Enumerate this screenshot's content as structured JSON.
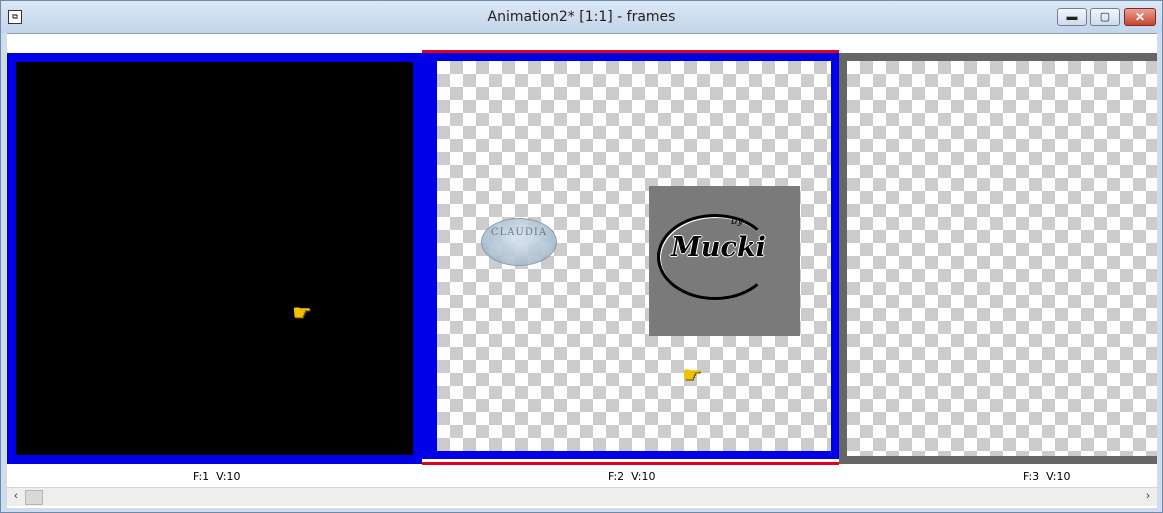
{
  "window": {
    "title": "Animation2* [1:1] - frames",
    "icon": "app-icon",
    "controls": {
      "minimize_glyph": "▬",
      "maximize_glyph": "▢",
      "close_glyph": "✕"
    }
  },
  "frames": [
    {
      "label": "F:1  V:10",
      "background": "#000000",
      "selected": true
    },
    {
      "label": "F:2  V:10",
      "background": "transparent-checker",
      "selected": true,
      "current": true,
      "stamp_text": "CLAUDIA",
      "logo_text": "Mucki",
      "logo_small": "by"
    },
    {
      "label": "F:3  V:10",
      "background": "transparent-checker",
      "selected": false
    }
  ],
  "colors": {
    "selection_border": "#0000e6",
    "current_frame_marker": "#e0001a",
    "frame_border": "#666666"
  },
  "scrollbar": {
    "left_glyph": "‹",
    "right_glyph": "›"
  },
  "cursor_glyph": "☛"
}
